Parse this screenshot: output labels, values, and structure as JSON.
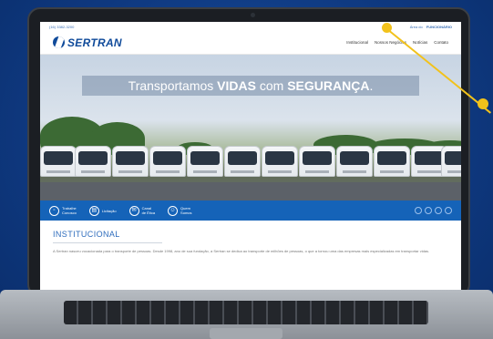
{
  "site": {
    "phone": "(16) 3382-3200",
    "top_links": [
      "Área do",
      "FUNCIONÁRIO"
    ],
    "logo_text": "SERTRAN",
    "nav": [
      "Institucional",
      "Nossos Negócios",
      "Notícias",
      "Contato"
    ]
  },
  "hero": {
    "headline_pre": "Transportamos ",
    "headline_b1": "VIDAS",
    "headline_mid": " com ",
    "headline_b2": "SEGURANÇA",
    "headline_post": "."
  },
  "features": [
    {
      "line1": "Trabalhe",
      "line2": "Conosco",
      "icon": "briefcase-icon"
    },
    {
      "line1": "Licitação",
      "line2": "",
      "icon": "document-icon"
    },
    {
      "line1": "Canal",
      "line2": "de Ética",
      "icon": "chat-icon"
    },
    {
      "line1": "Quem",
      "line2": "Somos",
      "icon": "people-icon"
    }
  ],
  "social_icons": [
    "facebook-icon",
    "instagram-icon",
    "linkedin-icon",
    "youtube-icon"
  ],
  "institucional": {
    "title": "INSTITUCIONAL",
    "text": "A Sertran nasceu vocacionada para o transporte de pessoas. Desde 1998, ano de sua fundação, a Sertran se dedica ao transporte de milhões de pessoas, o que a tornou uma das empresas mais especializadas em transportar vidas."
  },
  "colors": {
    "brand_blue": "#0f4a9a",
    "feature_bar": "#1563b8",
    "accent_yellow": "#f2c21b"
  }
}
